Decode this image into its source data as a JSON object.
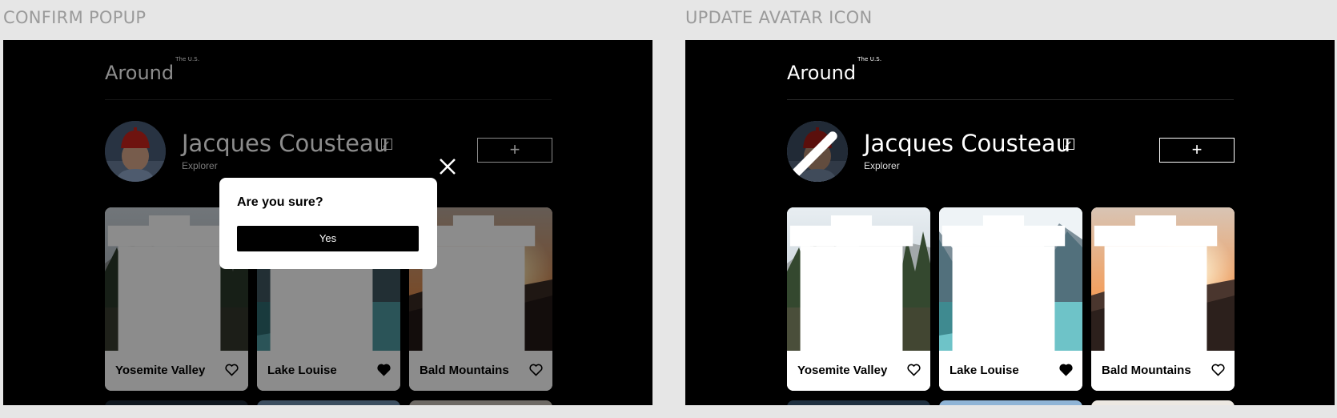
{
  "frames": [
    {
      "label": "CONFIRM POPUP",
      "logo": "Around",
      "logo_sup": "The U.S.",
      "profile": {
        "name": "Jacques Cousteau",
        "role": "Explorer",
        "add_symbol": "+"
      },
      "cards": [
        {
          "title": "Yosemite Valley",
          "liked": false
        },
        {
          "title": "Lake Louise",
          "liked": true
        },
        {
          "title": "Bald Mountains",
          "liked": false
        }
      ],
      "popup": {
        "title": "Are you sure?",
        "button": "Yes"
      }
    },
    {
      "label": "UPDATE AVATAR ICON",
      "logo": "Around",
      "logo_sup": "The U.S.",
      "profile": {
        "name": "Jacques Cousteau",
        "role": "Explorer",
        "add_symbol": "+"
      },
      "cards": [
        {
          "title": "Yosemite Valley",
          "liked": false
        },
        {
          "title": "Lake Louise",
          "liked": true
        },
        {
          "title": "Bald Mountains",
          "liked": false
        }
      ]
    }
  ],
  "colors": {
    "background": "#000000",
    "canvas": "#e6e6e6",
    "text": "#ffffff",
    "label": "#9a9a9a"
  },
  "icons": [
    "edit-icon",
    "plus-icon",
    "heart-icon",
    "heart-filled-icon",
    "trash-icon",
    "close-icon",
    "pencil-icon"
  ]
}
